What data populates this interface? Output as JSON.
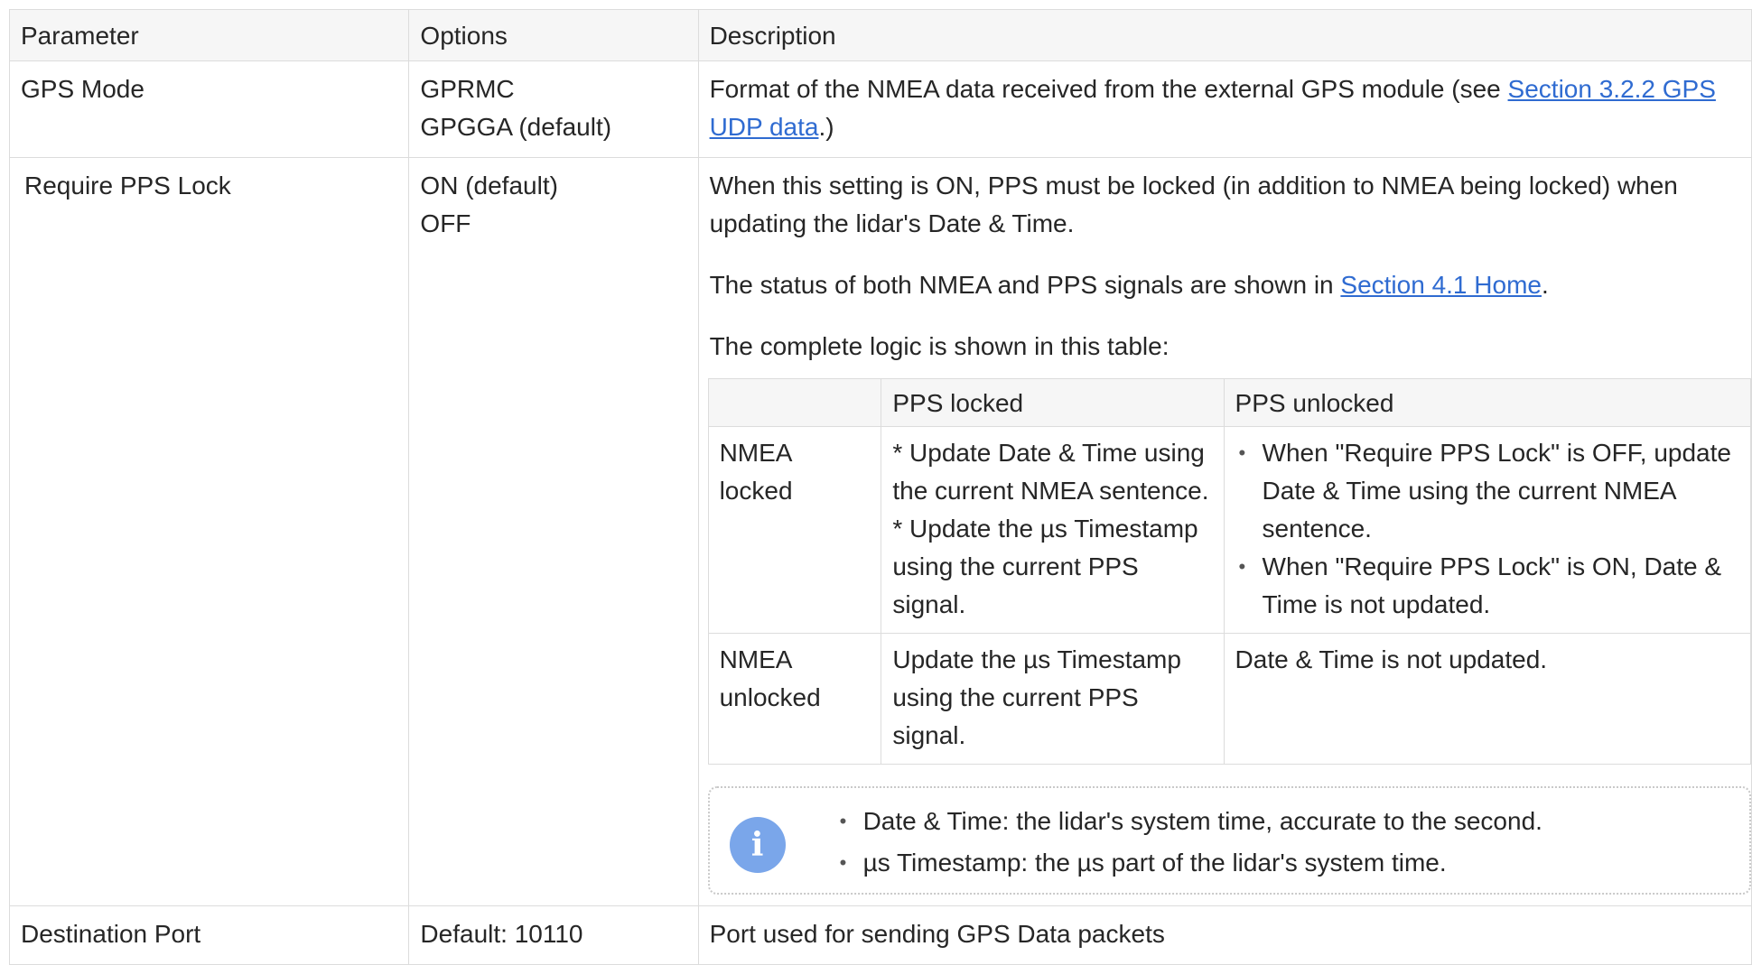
{
  "table": {
    "headers": [
      "Parameter",
      "Options",
      "Description"
    ],
    "rows": {
      "gps_mode": {
        "parameter": "GPS Mode",
        "options": [
          "GPRMC",
          "GPGGA (default)"
        ],
        "description": {
          "before": "Format of the NMEA data received from the external GPS module (see ",
          "link": "Section 3.2.2 GPS UDP data",
          "after": ".)"
        }
      },
      "require_pps": {
        "parameter": "Require PPS Lock",
        "options": [
          "ON (default)",
          "OFF"
        ],
        "para1": "When this setting is ON, PPS must be locked (in addition to NMEA being locked) when updating the lidar's Date & Time.",
        "para2": {
          "before": "The status of both NMEA and PPS signals are shown in ",
          "link": "Section 4.1 Home",
          "after": "."
        },
        "para3": "The complete logic is shown in this table:",
        "logic_table": {
          "headers": [
            "",
            "PPS locked",
            "PPS unlocked"
          ],
          "rows": [
            {
              "label": "NMEA locked",
              "pps_locked": [
                "* Update Date & Time using the current NMEA sentence.",
                "* Update the µs Timestamp using the current PPS signal."
              ],
              "pps_unlocked": [
                "When \"Require PPS Lock\" is OFF, update Date & Time using the current NMEA sentence.",
                "When \"Require PPS Lock\" is ON, Date & Time is not updated."
              ]
            },
            {
              "label": "NMEA unlocked",
              "pps_locked": "Update the µs Timestamp using the current PPS signal.",
              "pps_unlocked": "Date & Time is not updated."
            }
          ]
        },
        "note": {
          "icon": "info-icon",
          "items": [
            "Date & Time: the lidar's system time, accurate to the second.",
            "µs Timestamp: the µs part of the lidar's system time."
          ]
        }
      },
      "destination_port": {
        "parameter": "Destination Port",
        "options": "Default: 10110",
        "description": "Port used for sending GPS Data packets"
      }
    }
  }
}
